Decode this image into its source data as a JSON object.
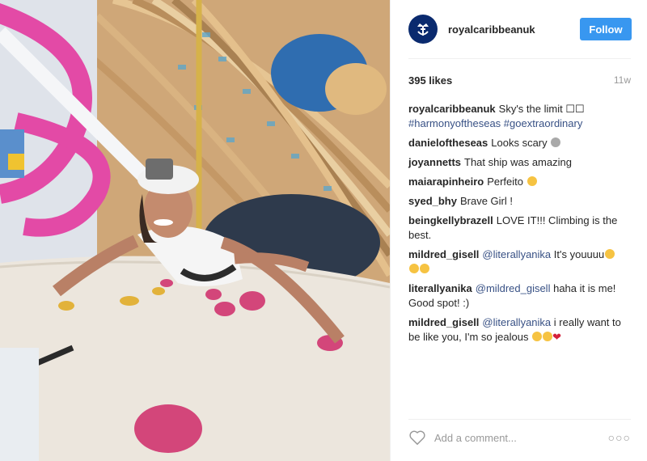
{
  "post": {
    "photo_icon": "photo-of-climber-on-rock-wall",
    "header": {
      "avatar_icon": "crown-anchor-logo-icon",
      "username": "royalcaribbeanuk",
      "follow_label": "Follow"
    },
    "likes": "395 likes",
    "time": "11w",
    "caption": {
      "user": "royalcaribbeanuk",
      "text": "Sky's the limit ☐☐",
      "tags": "#harmonyoftheseas #goextraordinary"
    },
    "comments": [
      {
        "user": "danieloftheseas",
        "text": "Looks scary"
      },
      {
        "user": "joyannetts",
        "text": "That ship was amazing"
      },
      {
        "user": "maiarapinheiro",
        "text": "Perfeito"
      },
      {
        "user": "syed_bhy",
        "text": "Brave Girl !"
      },
      {
        "user": "beingkellybrazell",
        "text": "LOVE IT!!! Climbing is the best."
      },
      {
        "user": "mildred_gisell",
        "mention": "@literallyanika",
        "text": "It's youuuu"
      },
      {
        "user": "literallyanika",
        "mention": "@mildred_gisell",
        "text": "haha it is me! Good spot! :)"
      },
      {
        "user": "mildred_gisell",
        "mention": "@literallyanika",
        "text": "i really want to be like you, I'm so jealous"
      }
    ],
    "add_comment_placeholder": "Add a comment...",
    "more_label": "○○○",
    "colors": {
      "follow": "#3897f0",
      "link": "#385185",
      "avatar": "#0a2a6e"
    }
  }
}
